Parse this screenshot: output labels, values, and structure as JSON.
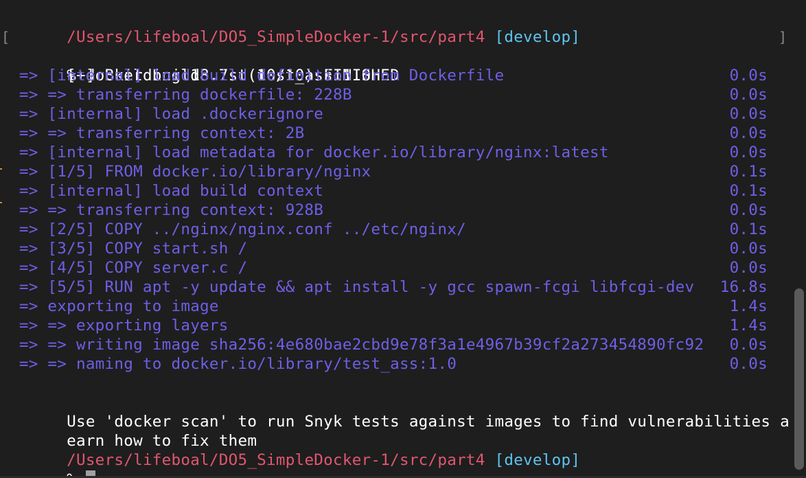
{
  "prompt1": {
    "path": "/Users/lifeboal/DO5_SimpleDocker-1/src/part4",
    "branch": "[develop]"
  },
  "command": "% docker build . -t test_ass:1.0",
  "build_header": "[+] Building 18.7s (10/10) FINISHED",
  "steps": [
    {
      "text": " => [internal] load build definition from Dockerfile",
      "time": "0.0s"
    },
    {
      "text": " => => transferring dockerfile: 228B",
      "time": "0.0s"
    },
    {
      "text": " => [internal] load .dockerignore",
      "time": "0.0s"
    },
    {
      "text": " => => transferring context: 2B",
      "time": "0.0s"
    },
    {
      "text": " => [internal] load metadata for docker.io/library/nginx:latest",
      "time": "0.0s"
    },
    {
      "text": " => [1/5] FROM docker.io/library/nginx",
      "time": "0.1s"
    },
    {
      "text": " => [internal] load build context",
      "time": "0.1s"
    },
    {
      "text": " => => transferring context: 928B",
      "time": "0.0s"
    },
    {
      "text": " => [2/5] COPY ../nginx/nginx.conf ../etc/nginx/",
      "time": "0.1s"
    },
    {
      "text": " => [3/5] COPY start.sh /",
      "time": "0.0s"
    },
    {
      "text": " => [4/5] COPY server.c /",
      "time": "0.0s"
    },
    {
      "text": " => [5/5] RUN apt -y update && apt install -y gcc spawn-fcgi libfcgi-dev",
      "time": "16.8s"
    },
    {
      "text": " => exporting to image",
      "time": "1.4s"
    },
    {
      "text": " => => exporting layers",
      "time": "1.4s"
    },
    {
      "text": " => => writing image sha256:4e680bae2cbd9e78f3a1e4967b39cf2a273454890fc92",
      "time": "0.0s"
    },
    {
      "text": " => => naming to docker.io/library/test_ass:1.0",
      "time": "0.0s"
    }
  ],
  "scan_message_line1": "Use 'docker scan' to run Snyk tests against images to find vulnerabilities and l",
  "scan_message_line2": "earn how to fix them",
  "prompt2": {
    "path": "/Users/lifeboal/DO5_SimpleDocker-1/src/part4",
    "branch": "[develop]"
  },
  "final_prompt": "%",
  "colors": {
    "background": "#1e1e1e",
    "path": "#e2566f",
    "branch": "#5cc4ef",
    "build_step": "#6e5fe6",
    "text": "#ffffff"
  }
}
